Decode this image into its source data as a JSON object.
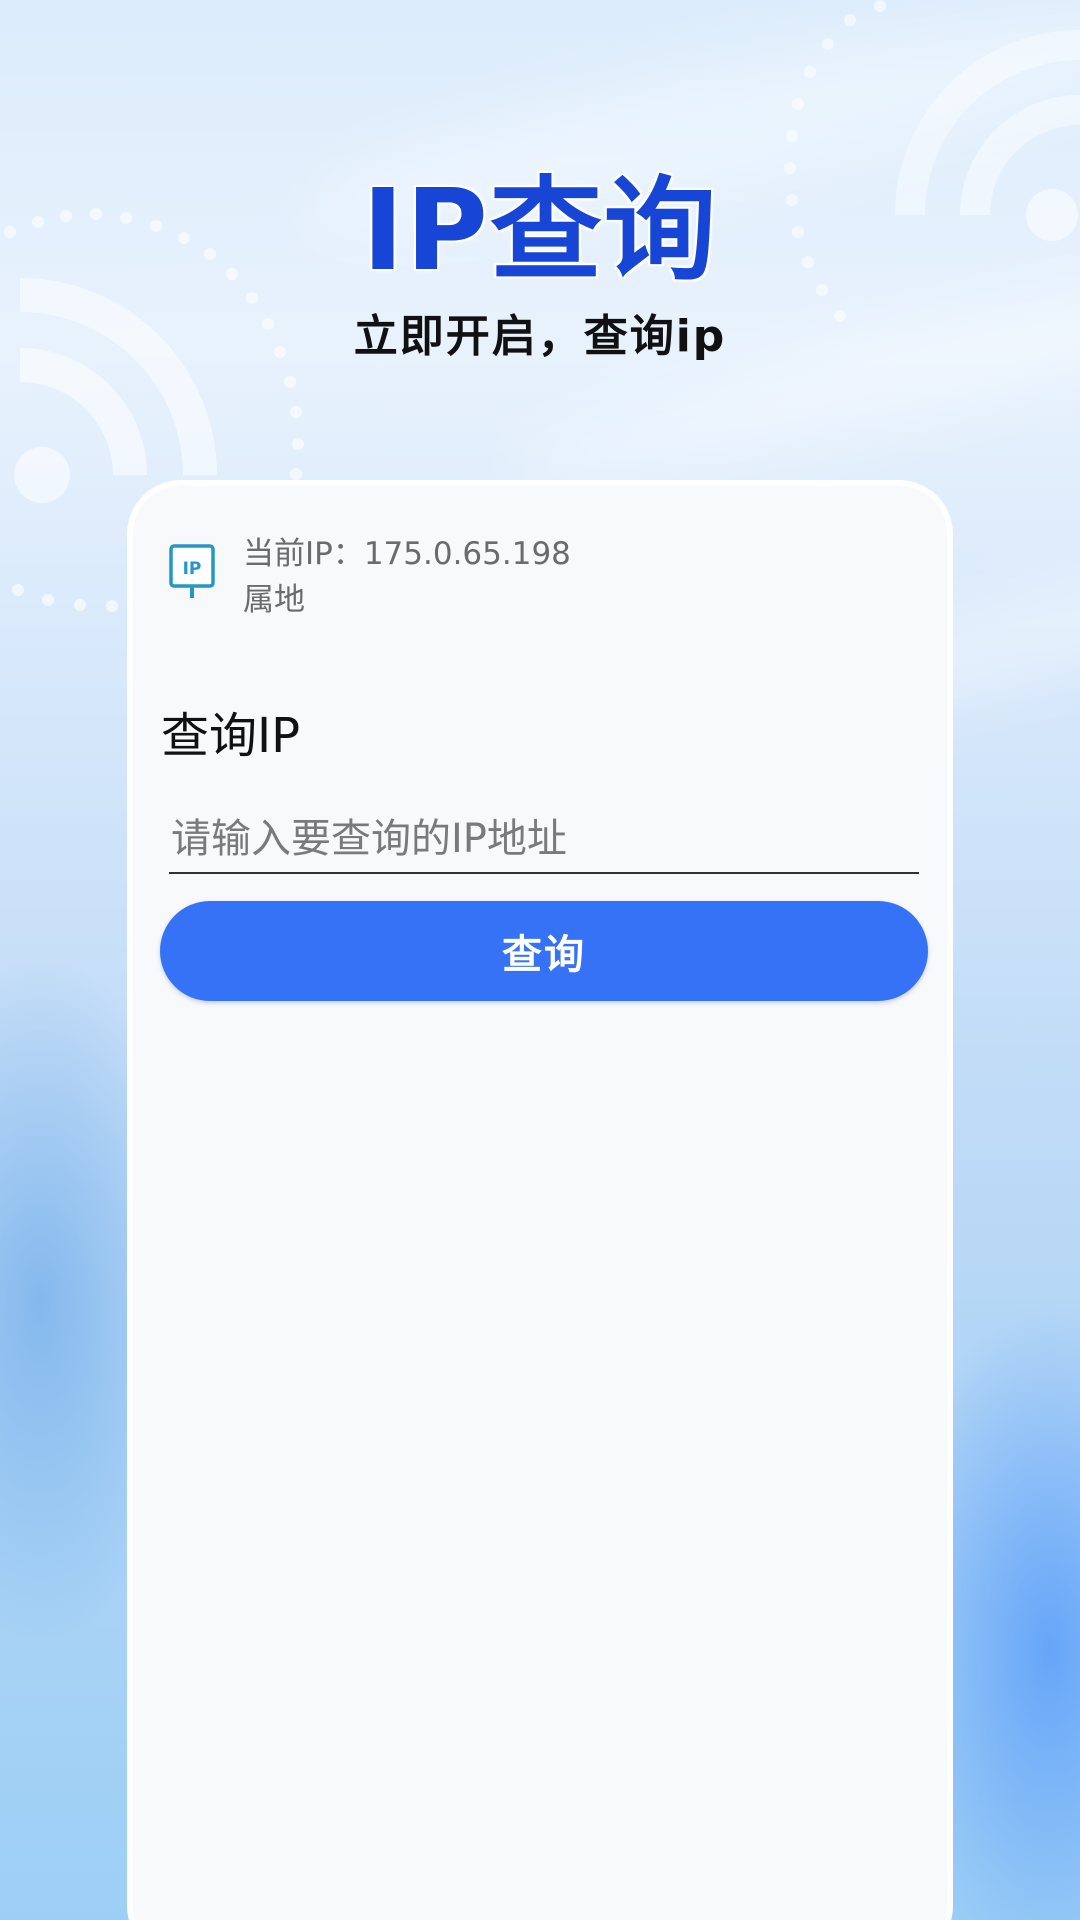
{
  "header": {
    "title": "IP查询",
    "subtitle": "立即开启，查询ip"
  },
  "card": {
    "icon": "ip-monitor-icon",
    "icon_text": "IP",
    "current_ip_label": "当前IP：175.0.65.198",
    "location_label": "属地",
    "section_title": "查询IP",
    "input": {
      "placeholder": "请输入要查询的IP地址",
      "value": ""
    },
    "query_button_label": "查询"
  },
  "colors": {
    "title": "#1746d6",
    "button": "#3572f6",
    "card_bg": "#f8f9fb"
  }
}
